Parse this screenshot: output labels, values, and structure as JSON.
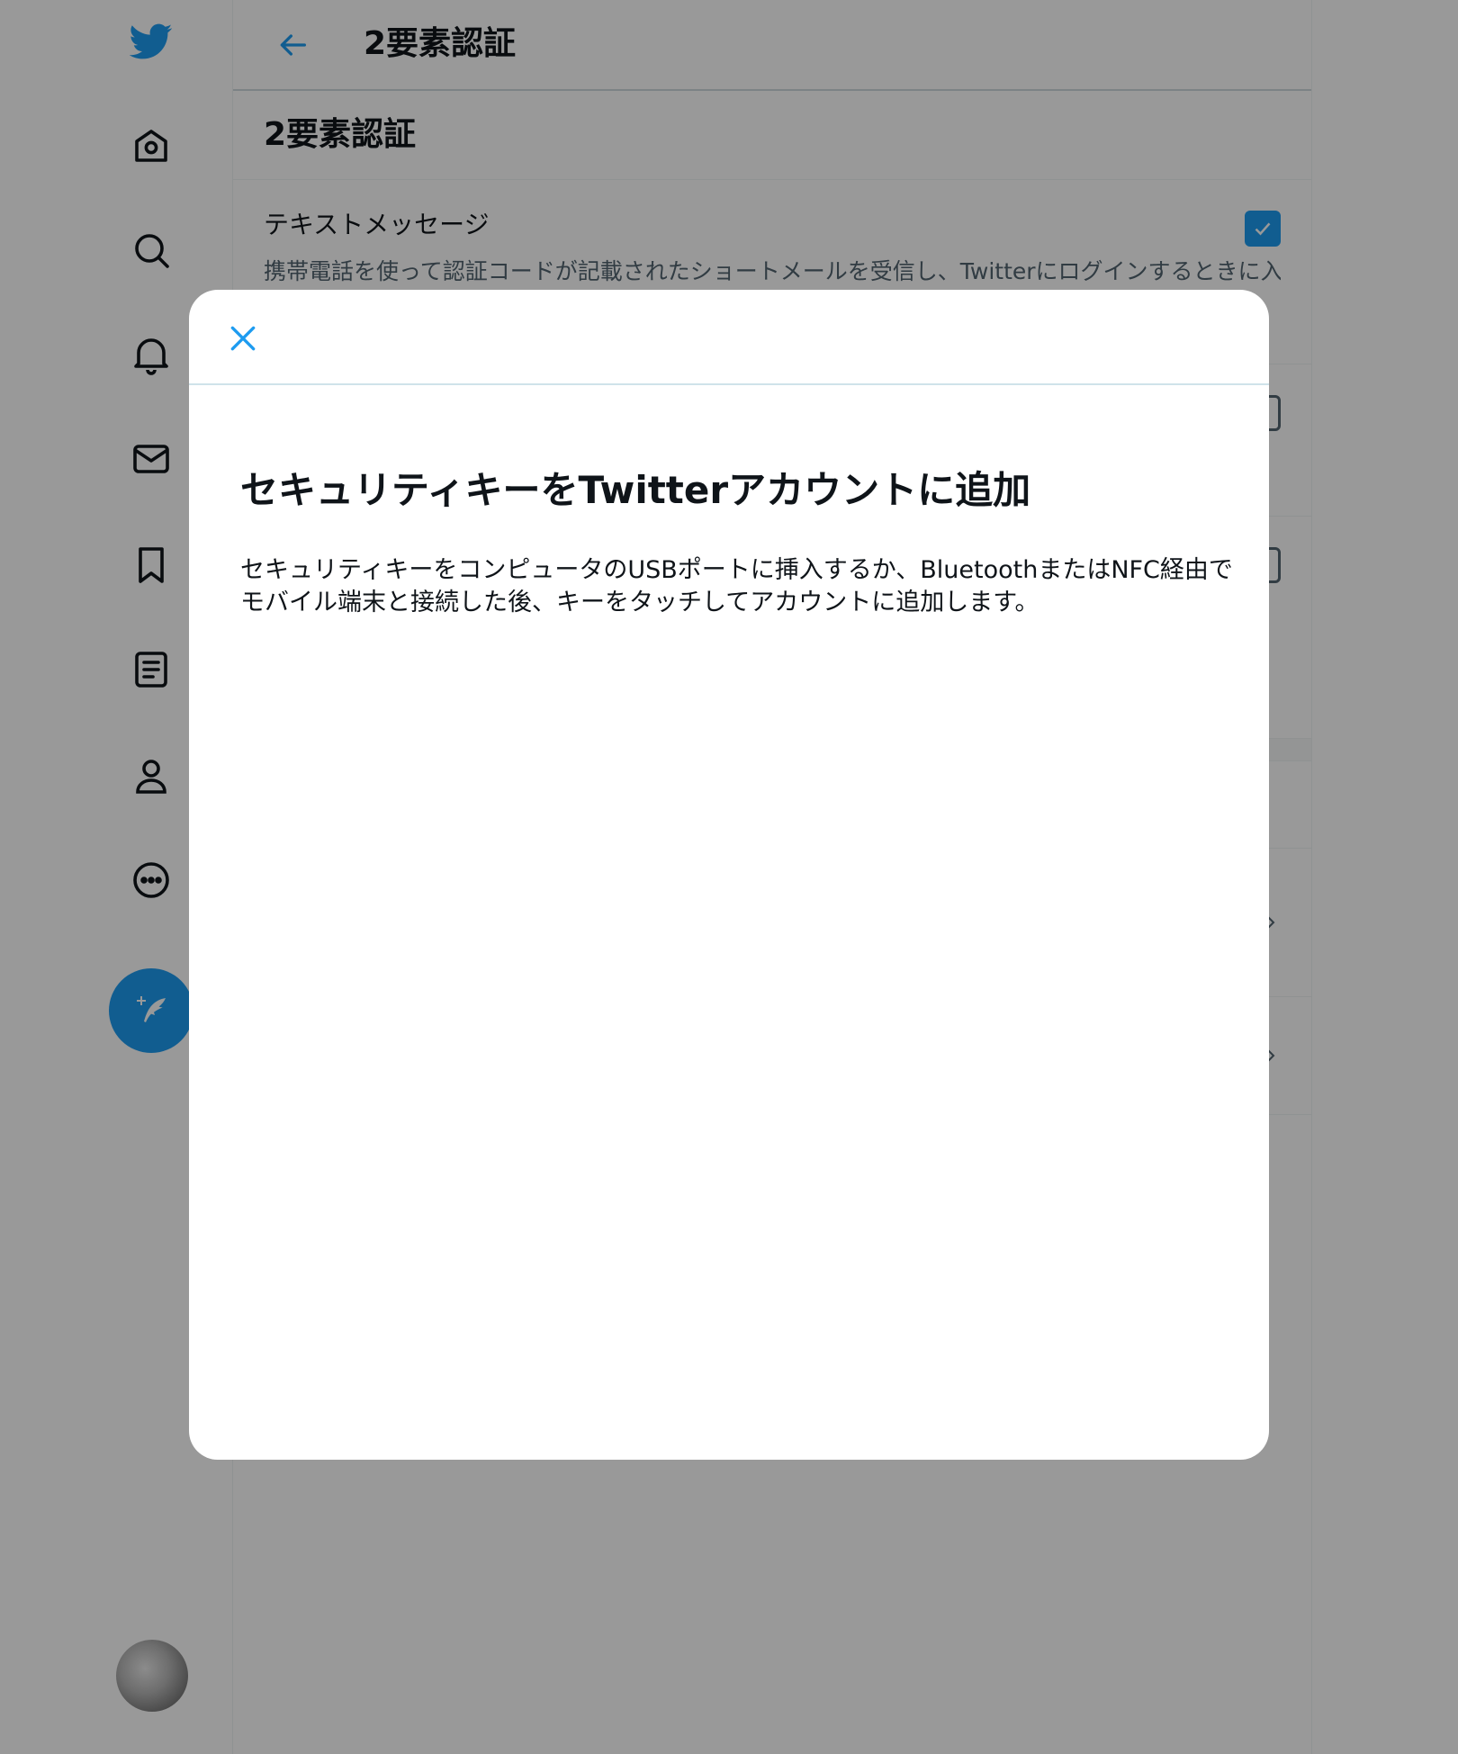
{
  "app": {
    "logo": "twitter-bird-icon",
    "brand_color": "#1d9bf0"
  },
  "nav": {
    "items": [
      {
        "icon": "home-icon"
      },
      {
        "icon": "search-icon"
      },
      {
        "icon": "notifications-bell-icon"
      },
      {
        "icon": "messages-envelope-icon"
      },
      {
        "icon": "bookmark-icon"
      },
      {
        "icon": "lists-icon"
      },
      {
        "icon": "profile-person-icon"
      },
      {
        "icon": "more-icon"
      }
    ],
    "compose_icon": "compose-tweet-icon"
  },
  "header": {
    "title": "2要素認証"
  },
  "settings": {
    "section_title": "2要素認証",
    "text_message": {
      "label": "テキストメッセージ",
      "description": "携帯電話を使って認証コードが記載されたショートメールを受信し、Twitterにログインするときに入力",
      "checked": true
    }
  },
  "modal": {
    "title": "セキュリティキーをTwitterアカウントに追加",
    "description": "セキュリティキーをコンピュータのUSBポートに挿入するか、BluetoothまたはNFC経由でモバイル端末と接続した後、キーをタッチしてアカウントに追加します。"
  }
}
